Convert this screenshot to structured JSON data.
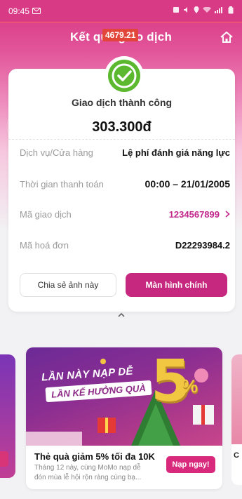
{
  "status_bar": {
    "time": "09:45"
  },
  "nav": {
    "title": "Kết quả giao dịch",
    "overlay_badge": "4679.21"
  },
  "result": {
    "status": "Giao dịch thành công",
    "amount": "303.300đ"
  },
  "details": [
    {
      "label": "Dịch vụ/Cửa hàng",
      "value": "Lệ phí đánh giá năng lực"
    },
    {
      "label": "Thời gian thanh toán",
      "value": "00:00 – 21/01/2005"
    },
    {
      "label": "Mã giao dịch",
      "value": "1234567899"
    },
    {
      "label": "Mã hoá đơn",
      "value": "D22293984.2"
    }
  ],
  "actions": {
    "share_label": "Chia sẻ ảnh này",
    "main_label": "Màn hình chính"
  },
  "promo": {
    "image_line1": "LẦN NÀY NẠP DỄ",
    "image_line2": "LẦN KẾ HƯỞNG QUÀ",
    "image_big": "5",
    "image_pct": "%",
    "title": "Thẻ quà giảm 5% tối đa 10K",
    "desc_line1": "Tháng 12 này, cùng MoMo nạp dễ",
    "desc_line2": "đón mùa lễ hội rộn ràng cùng bạ...",
    "cta": "Nạp ngay!"
  },
  "side_promo_right": {
    "label": "C"
  },
  "colors": {
    "brand": "#c7287f",
    "success": "#5cb82e",
    "link": "#c2288c"
  },
  "icons": [
    "check-icon",
    "home-icon",
    "chevron-right-icon",
    "chevron-up-icon",
    "wifi-icon",
    "battery-icon",
    "signal-icon"
  ]
}
